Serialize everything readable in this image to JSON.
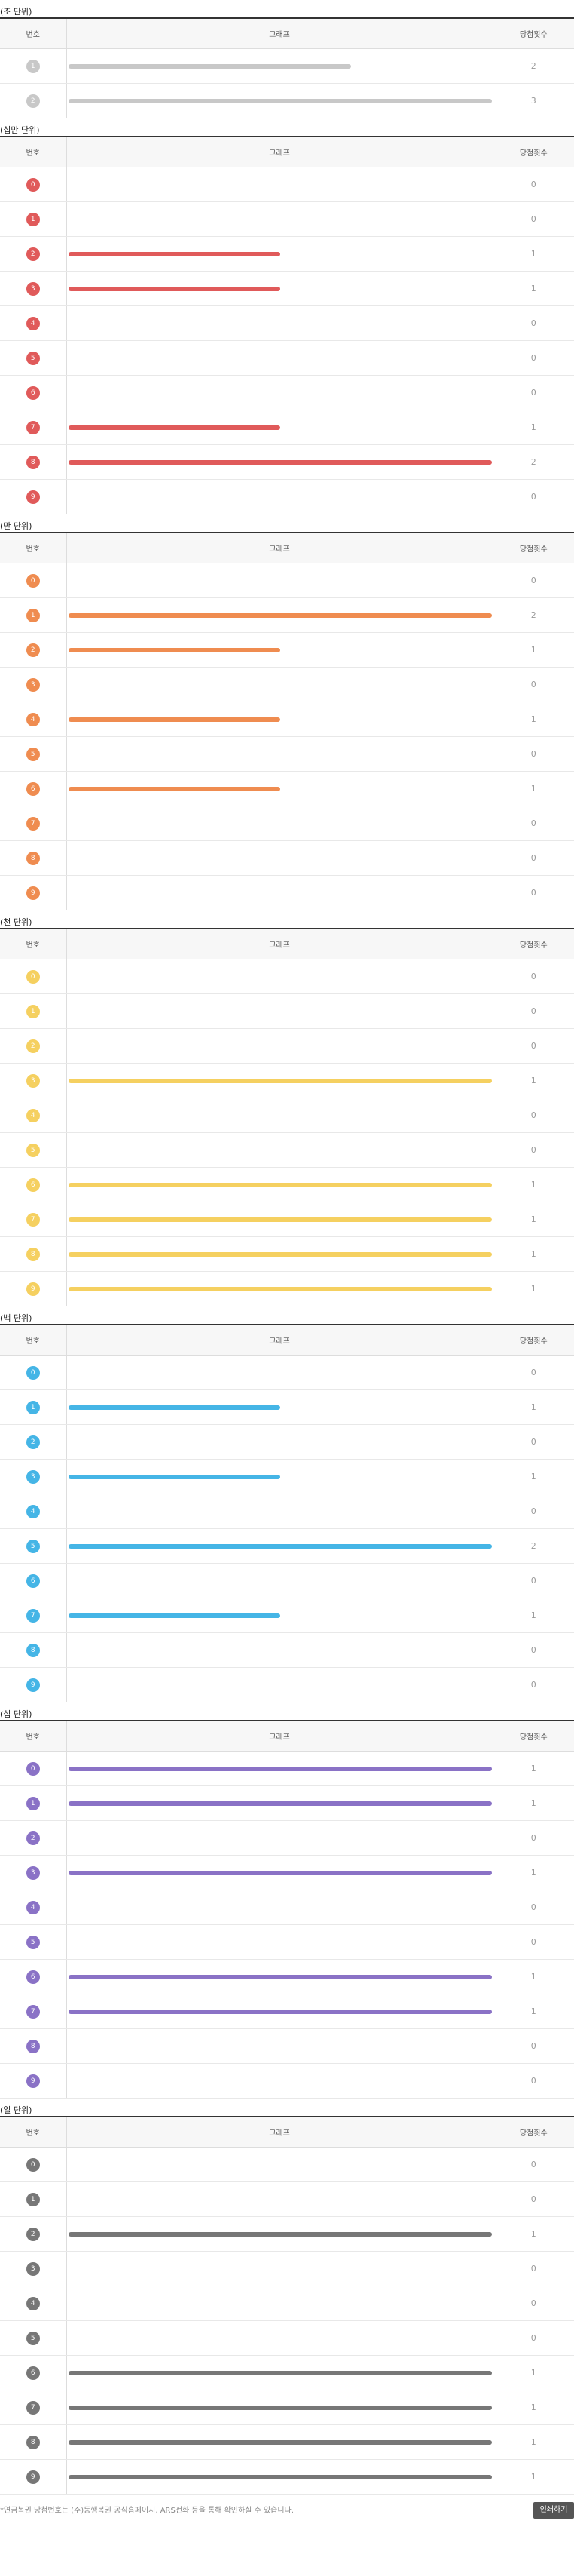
{
  "table_headers": {
    "number": "번호",
    "graph": "그래프",
    "count": "당첨횟수"
  },
  "footer": {
    "note": "*연금복권 당첨번호는 (주)동행복권 공식홈페이지, ARS전화 등을 통해 확인하실 수 있습니다.",
    "print_label": "인쇄하기"
  },
  "groups": [
    {
      "title": "(조 단위)",
      "color": "#c8c8c8",
      "rows": [
        {
          "ball": "1",
          "count": "2",
          "ratio": 0.667
        },
        {
          "ball": "2",
          "count": "3",
          "ratio": 1.0
        }
      ]
    },
    {
      "title": "(십만 단위)",
      "color": "#e05a5a",
      "rows": [
        {
          "ball": "0",
          "count": "0",
          "ratio": 0
        },
        {
          "ball": "1",
          "count": "0",
          "ratio": 0
        },
        {
          "ball": "2",
          "count": "1",
          "ratio": 0.5
        },
        {
          "ball": "3",
          "count": "1",
          "ratio": 0.5
        },
        {
          "ball": "4",
          "count": "0",
          "ratio": 0
        },
        {
          "ball": "5",
          "count": "0",
          "ratio": 0
        },
        {
          "ball": "6",
          "count": "0",
          "ratio": 0
        },
        {
          "ball": "7",
          "count": "1",
          "ratio": 0.5
        },
        {
          "ball": "8",
          "count": "2",
          "ratio": 1.0
        },
        {
          "ball": "9",
          "count": "0",
          "ratio": 0
        }
      ]
    },
    {
      "title": "(만 단위)",
      "color": "#ef8c50",
      "rows": [
        {
          "ball": "0",
          "count": "0",
          "ratio": 0
        },
        {
          "ball": "1",
          "count": "2",
          "ratio": 1.0
        },
        {
          "ball": "2",
          "count": "1",
          "ratio": 0.5
        },
        {
          "ball": "3",
          "count": "0",
          "ratio": 0
        },
        {
          "ball": "4",
          "count": "1",
          "ratio": 0.5
        },
        {
          "ball": "5",
          "count": "0",
          "ratio": 0
        },
        {
          "ball": "6",
          "count": "1",
          "ratio": 0.5
        },
        {
          "ball": "7",
          "count": "0",
          "ratio": 0
        },
        {
          "ball": "8",
          "count": "0",
          "ratio": 0
        },
        {
          "ball": "9",
          "count": "0",
          "ratio": 0
        }
      ]
    },
    {
      "title": "(천 단위)",
      "color": "#f5d060",
      "rows": [
        {
          "ball": "0",
          "count": "0",
          "ratio": 0
        },
        {
          "ball": "1",
          "count": "0",
          "ratio": 0
        },
        {
          "ball": "2",
          "count": "0",
          "ratio": 0
        },
        {
          "ball": "3",
          "count": "1",
          "ratio": 1.0
        },
        {
          "ball": "4",
          "count": "0",
          "ratio": 0
        },
        {
          "ball": "5",
          "count": "0",
          "ratio": 0
        },
        {
          "ball": "6",
          "count": "1",
          "ratio": 1.0
        },
        {
          "ball": "7",
          "count": "1",
          "ratio": 1.0
        },
        {
          "ball": "8",
          "count": "1",
          "ratio": 1.0
        },
        {
          "ball": "9",
          "count": "1",
          "ratio": 1.0
        }
      ]
    },
    {
      "title": "(백 단위)",
      "color": "#45b5e6",
      "rows": [
        {
          "ball": "0",
          "count": "0",
          "ratio": 0
        },
        {
          "ball": "1",
          "count": "1",
          "ratio": 0.5
        },
        {
          "ball": "2",
          "count": "0",
          "ratio": 0
        },
        {
          "ball": "3",
          "count": "1",
          "ratio": 0.5
        },
        {
          "ball": "4",
          "count": "0",
          "ratio": 0
        },
        {
          "ball": "5",
          "count": "2",
          "ratio": 1.0
        },
        {
          "ball": "6",
          "count": "0",
          "ratio": 0
        },
        {
          "ball": "7",
          "count": "1",
          "ratio": 0.5
        },
        {
          "ball": "8",
          "count": "0",
          "ratio": 0
        },
        {
          "ball": "9",
          "count": "0",
          "ratio": 0
        }
      ]
    },
    {
      "title": "(십 단위)",
      "color": "#8a72c6",
      "rows": [
        {
          "ball": "0",
          "count": "1",
          "ratio": 1.0
        },
        {
          "ball": "1",
          "count": "1",
          "ratio": 1.0
        },
        {
          "ball": "2",
          "count": "0",
          "ratio": 0
        },
        {
          "ball": "3",
          "count": "1",
          "ratio": 1.0
        },
        {
          "ball": "4",
          "count": "0",
          "ratio": 0
        },
        {
          "ball": "5",
          "count": "0",
          "ratio": 0
        },
        {
          "ball": "6",
          "count": "1",
          "ratio": 1.0
        },
        {
          "ball": "7",
          "count": "1",
          "ratio": 1.0
        },
        {
          "ball": "8",
          "count": "0",
          "ratio": 0
        },
        {
          "ball": "9",
          "count": "0",
          "ratio": 0
        }
      ]
    },
    {
      "title": "(일 단위)",
      "color": "#777777",
      "rows": [
        {
          "ball": "0",
          "count": "0",
          "ratio": 0
        },
        {
          "ball": "1",
          "count": "0",
          "ratio": 0
        },
        {
          "ball": "2",
          "count": "1",
          "ratio": 1.0
        },
        {
          "ball": "3",
          "count": "0",
          "ratio": 0
        },
        {
          "ball": "4",
          "count": "0",
          "ratio": 0
        },
        {
          "ball": "5",
          "count": "0",
          "ratio": 0
        },
        {
          "ball": "6",
          "count": "1",
          "ratio": 1.0
        },
        {
          "ball": "7",
          "count": "1",
          "ratio": 1.0
        },
        {
          "ball": "8",
          "count": "1",
          "ratio": 1.0
        },
        {
          "ball": "9",
          "count": "1",
          "ratio": 1.0
        }
      ]
    }
  ]
}
